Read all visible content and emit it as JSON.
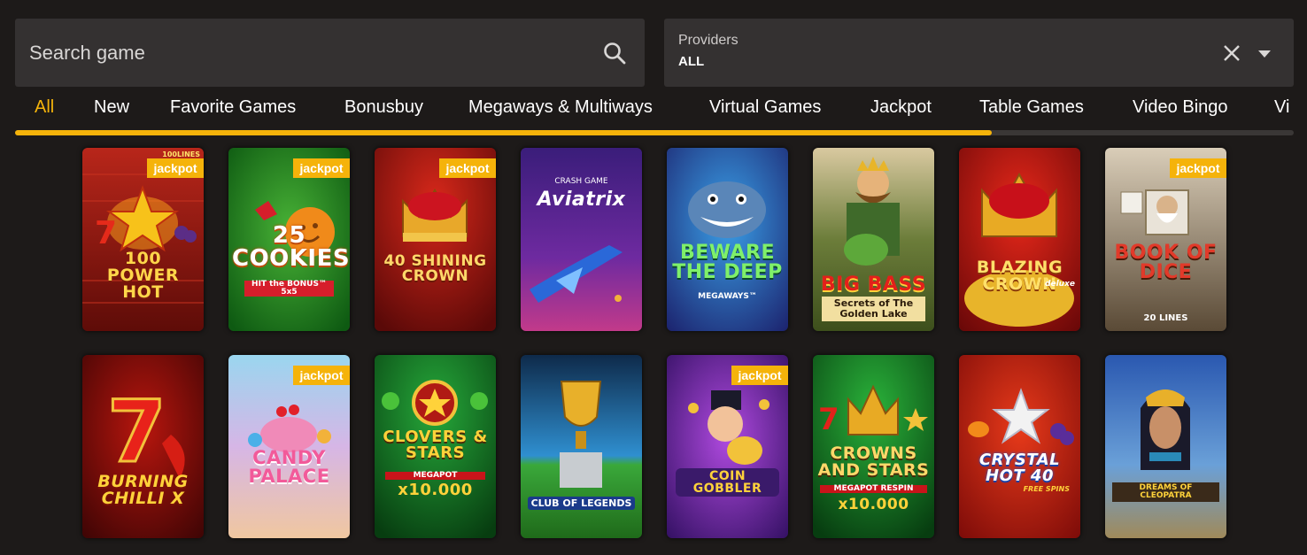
{
  "search": {
    "placeholder": "Search game"
  },
  "providers": {
    "label": "Providers",
    "value": "ALL"
  },
  "tabs": [
    "All",
    "New",
    "Favorite Games",
    "Bonusbuy",
    "Megaways & Multiways",
    "Virtual Games",
    "Jackpot",
    "Table Games",
    "Video Bingo",
    "Vi"
  ],
  "active_tab": "All",
  "accent_color": "#f5b30a",
  "jackpot_label": "jackpot",
  "games": [
    {
      "title": "100 POWER HOT",
      "top_text": "100LINES",
      "jackpot": true,
      "bg": "#8e1810"
    },
    {
      "title": "25 COOKIES",
      "sub": "HIT the BONUS™ 5x5",
      "jackpot": true,
      "bg": "#1f7d1a"
    },
    {
      "title": "40 SHINING CROWN",
      "jackpot": true,
      "bg": "#9c1413"
    },
    {
      "title": "Aviatrix",
      "top_text": "CRASH GAME",
      "jackpot": false,
      "bg": "#4a1f8a"
    },
    {
      "title": "BEWARE THE DEEP",
      "sub": "MEGAWAYS™",
      "jackpot": false,
      "bg": "#1b4ea2"
    },
    {
      "title": "BIG BASS",
      "sub": "Secrets of The Golden Lake",
      "jackpot": false,
      "bg": "#4d6b2a"
    },
    {
      "title": "BLAZING CROWN",
      "sub": "deluxe",
      "jackpot": false,
      "bg": "#b01414"
    },
    {
      "title": "BOOK OF DICE",
      "sub": "20 LINES",
      "jackpot": true,
      "bg": "#7a6a52"
    },
    {
      "title": "BURNING CHILLI X",
      "jackpot": false,
      "bg": "#7a0d0a"
    },
    {
      "title": "CANDY PALACE",
      "jackpot": true,
      "bg": "#c3a7d9"
    },
    {
      "title": "CLOVERS & STARS",
      "sub": "MEGAPOT",
      "amount": "x10.000",
      "jackpot": false,
      "bg": "#0f6b1b"
    },
    {
      "title": "CLUB OF LEGENDS",
      "jackpot": false,
      "bg": "#1d6f9c"
    },
    {
      "title": "COIN GOBBLER",
      "jackpot": true,
      "bg": "#5a1e8e"
    },
    {
      "title": "CROWNS AND STARS",
      "sub": "MEGAPOT RESPIN",
      "amount": "x10.000",
      "jackpot": false,
      "bg": "#136d1e"
    },
    {
      "title": "CRYSTAL HOT 40",
      "sub": "FREE SPINS",
      "jackpot": false,
      "bg": "#b31a12"
    },
    {
      "title": "DREAMS OF CLEOPATRA",
      "jackpot": false,
      "bg": "#2a4a86"
    }
  ]
}
